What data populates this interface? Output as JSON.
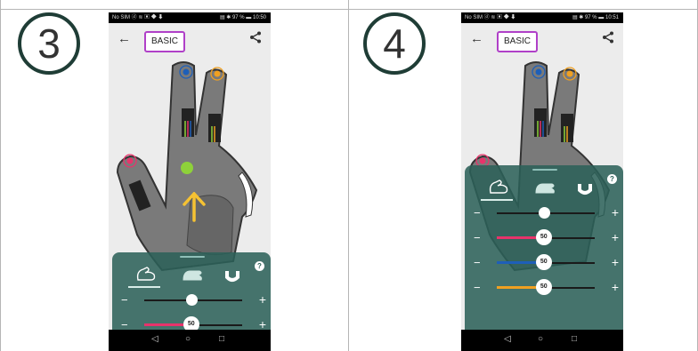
{
  "steps": [
    {
      "number": "3",
      "status_left": "No SIM ⓓ ≋ ▣ ◆ ⬇",
      "status_right": "▤ ✱ 97 % ▬ 10:50",
      "title": "BASIC",
      "sliders": [
        {
          "color": "#ffffff",
          "level": 0.48
        },
        {
          "color": "#e8336b",
          "level": 0.48,
          "value": "50"
        }
      ]
    },
    {
      "number": "4",
      "status_left": "No SIM ⓓ ≋ ▣ ◆ ⬇",
      "status_right": "▤ ✱ 97 % ▬ 10:51",
      "title": "BASIC",
      "sliders": [
        {
          "color": "#ffffff",
          "level": 0.48
        },
        {
          "color": "#e8336b",
          "level": 0.48,
          "value": "50"
        },
        {
          "color": "#1e5fb8",
          "level": 0.48,
          "value": "50"
        },
        {
          "color": "#f0a021",
          "level": 0.48,
          "value": "50"
        }
      ]
    }
  ],
  "colors": {
    "sheet": "#2c6058",
    "pink": "#e8336b",
    "blue": "#1e5fb8",
    "orange": "#f0a021",
    "green": "#8ed13a",
    "arrow": "#f5c233",
    "title_border": "#b040c8"
  },
  "icons": [
    "arrow-left-icon",
    "share-icon",
    "bicep-icon",
    "hand-heat-icon",
    "magnet-icon",
    "help-icon",
    "nav-back-icon",
    "nav-home-icon",
    "nav-recent-icon"
  ]
}
